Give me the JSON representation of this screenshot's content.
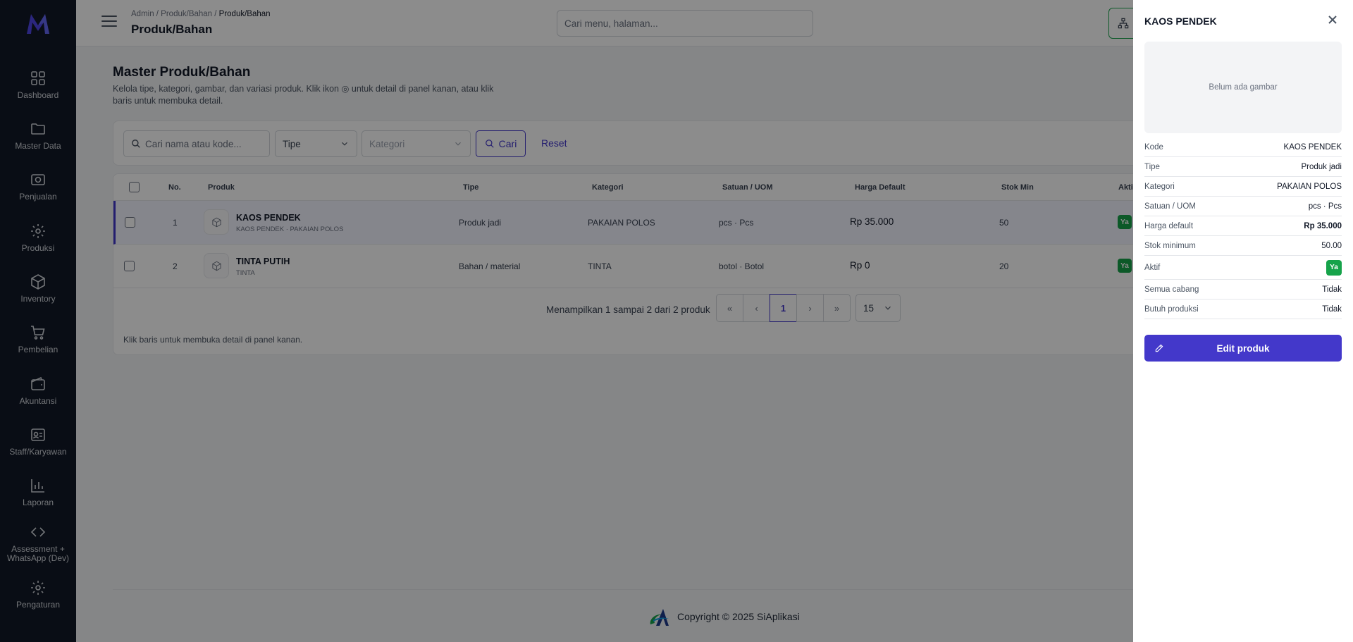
{
  "sidebar": {
    "items": [
      {
        "label": "Dashboard",
        "icon": "grid-icon"
      },
      {
        "label": "Master Data",
        "icon": "folder-icon"
      },
      {
        "label": "Penjualan",
        "icon": "camera-icon"
      },
      {
        "label": "Produksi",
        "icon": "gear-icon"
      },
      {
        "label": "Inventory",
        "icon": "box-icon"
      },
      {
        "label": "Pembelian",
        "icon": "cart-icon"
      },
      {
        "label": "Akuntansi",
        "icon": "wallet-icon"
      },
      {
        "label": "Staff/Karyawan",
        "icon": "id-card-icon"
      },
      {
        "label": "Laporan",
        "icon": "bar-chart-icon"
      },
      {
        "label": "Assessment + WhatsApp (Dev)",
        "icon": "code-icon"
      },
      {
        "label": "Pengaturan",
        "icon": "gear-icon"
      }
    ]
  },
  "header": {
    "breadcrumb_prefix": "Admin / Produk/Bahan / ",
    "breadcrumb_current": "Produk/Bahan",
    "title": "Produk/Bahan",
    "search_placeholder": "Cari menu, halaman..."
  },
  "main": {
    "title": "Master Produk/Bahan",
    "subtitle": "Kelola tipe, kategori, gambar, dan variasi produk. Klik ikon ◎ untuk detail di panel kanan, atau klik baris untuk membuka detail.",
    "filters": {
      "search_placeholder": "Cari nama atau kode...",
      "tipe": "Tipe",
      "kategori": "Kategori",
      "cari": "Cari",
      "reset": "Reset"
    },
    "table": {
      "columns": [
        "No.",
        "Produk",
        "Tipe",
        "Kategori",
        "Satuan / UOM",
        "Harga Default",
        "Stok Min",
        "Aktif"
      ],
      "rows": [
        {
          "no": "1",
          "name": "KAOS PENDEK",
          "sub": "KAOS PENDEK · PAKAIAN POLOS",
          "tipe": "Produk jadi",
          "kategori": "PAKAIAN POLOS",
          "uom": "pcs · Pcs",
          "harga": "Rp 35.000",
          "stok": "50",
          "aktif": "Ya"
        },
        {
          "no": "2",
          "name": "TINTA PUTIH",
          "sub": "TINTA",
          "tipe": "Bahan / material",
          "kategori": "TINTA",
          "uom": "botol · Botol",
          "harga": "Rp 0",
          "stok": "20",
          "aktif": "Ya"
        }
      ]
    },
    "pagination": {
      "summary": "Menampilkan 1 sampai 2 dari 2 produk",
      "first": "«",
      "prev": "‹",
      "current": "1",
      "next": "›",
      "last": "»",
      "page_size": "15"
    },
    "hint": "Klik baris untuk membuka detail di panel kanan.",
    "copyright": "Copyright © 2025 SiAplikasi"
  },
  "drawer": {
    "title": "KAOS PENDEK",
    "image_placeholder": "Belum ada gambar",
    "rows": [
      {
        "k": "Kode",
        "v": "KAOS PENDEK"
      },
      {
        "k": "Tipe",
        "v": "Produk jadi"
      },
      {
        "k": "Kategori",
        "v": "PAKAIAN POLOS"
      },
      {
        "k": "Satuan / UOM",
        "v": "pcs · Pcs"
      },
      {
        "k": "Harga default",
        "v": "Rp 35.000"
      },
      {
        "k": "Stok minimum",
        "v": "50.00"
      },
      {
        "k": "Aktif",
        "v": "Ya"
      },
      {
        "k": "Semua cabang",
        "v": "Tidak"
      },
      {
        "k": "Butuh produksi",
        "v": "Tidak"
      }
    ],
    "edit_label": "Edit produk"
  },
  "colors": {
    "sidebar_bg": "#111827",
    "accent": "#4338ca",
    "success": "#16a34a"
  }
}
